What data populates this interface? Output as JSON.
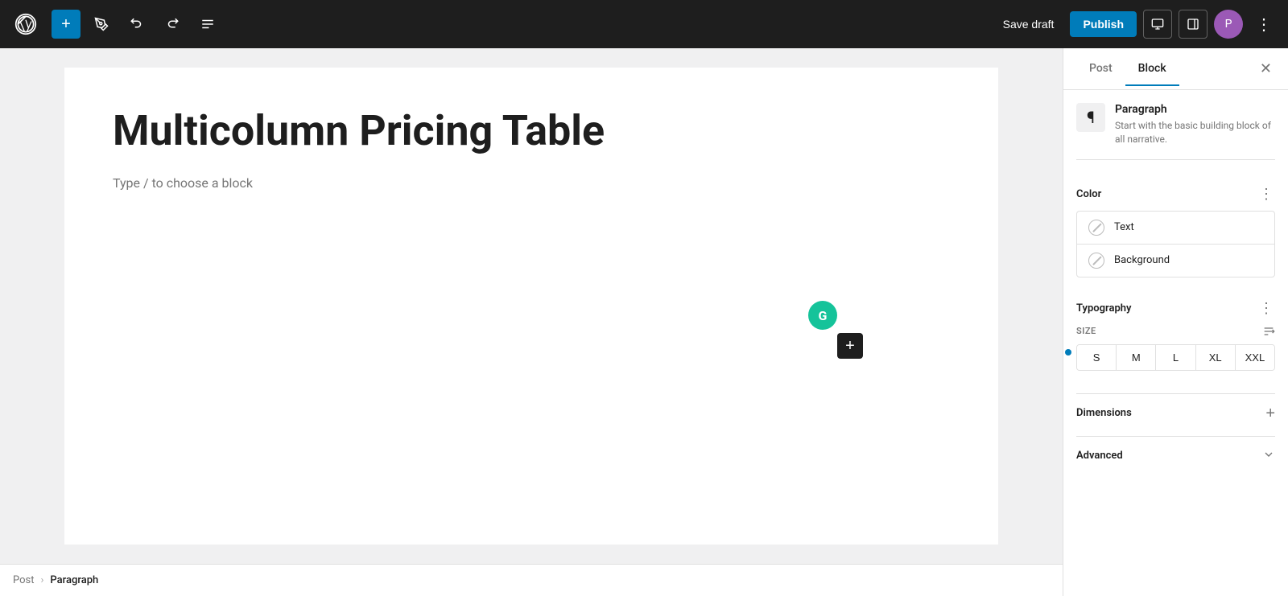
{
  "toolbar": {
    "add_label": "+",
    "save_draft_label": "Save draft",
    "publish_label": "Publish",
    "more_icon": "⋮"
  },
  "editor": {
    "post_title": "Multicolumn Pricing Table",
    "placeholder_text": "Type / to choose a block"
  },
  "breadcrumb": {
    "post_label": "Post",
    "separator": "›",
    "paragraph_label": "Paragraph"
  },
  "sidebar": {
    "tab_post_label": "Post",
    "tab_block_label": "Block",
    "block_name": "Paragraph",
    "block_desc": "Start with the basic building block of all narrative.",
    "color_section_title": "Color",
    "text_color_label": "Text",
    "background_color_label": "Background",
    "typography_section_title": "Typography",
    "size_label": "SIZE",
    "size_options": [
      "S",
      "M",
      "L",
      "XL",
      "XXL"
    ],
    "dimensions_section_title": "Dimensions",
    "advanced_section_title": "Advanced"
  }
}
